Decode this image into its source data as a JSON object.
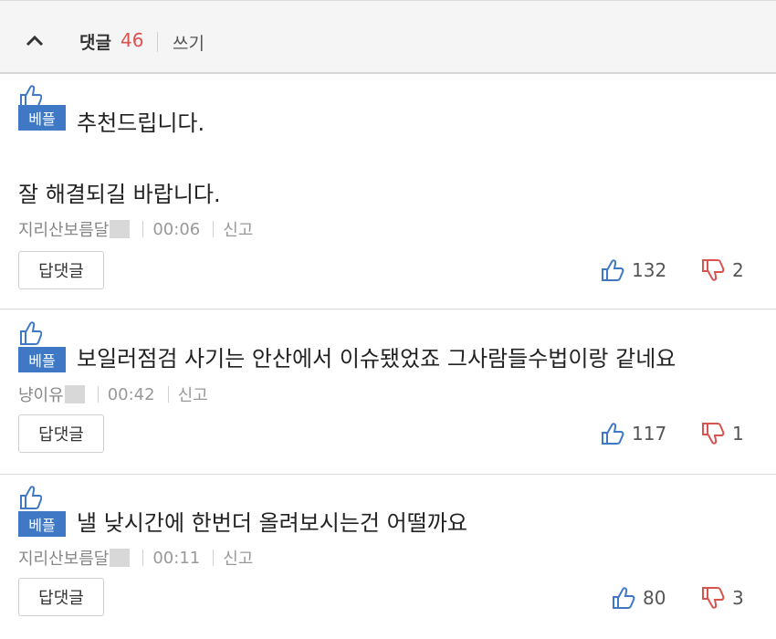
{
  "header": {
    "title": "댓글",
    "count": "46",
    "write_label": "쓰기"
  },
  "comments": [
    {
      "badge": "베플",
      "text_line1": "추천드립니다.",
      "text_line2": "잘 해결되길 바랍니다.",
      "author": "지리산보름달",
      "time": "00:06",
      "report": "신고",
      "reply_label": "답댓글",
      "likes": "132",
      "dislikes": "2"
    },
    {
      "badge": "베플",
      "text_line1": "보일러점검 사기는 안산에서 이슈됐었죠 그사람들수법이랑 같네요",
      "author": "냥이유",
      "time": "00:42",
      "report": "신고",
      "reply_label": "답댓글",
      "likes": "117",
      "dislikes": "1"
    },
    {
      "badge": "베플",
      "text_line1": "낼 낮시간에 한번더 올려보시는건 어떨까요",
      "author": "지리산보름달",
      "time": "00:11",
      "report": "신고",
      "reply_label": "답댓글",
      "likes": "80",
      "dislikes": "3"
    }
  ],
  "colors": {
    "badge": "#3f78c4",
    "like_icon": "#3f78c4",
    "dislike_icon": "#d9534f",
    "count": "#d9534f"
  },
  "icons": {
    "collapse": "chevron-up-icon",
    "badge": "thumbs-up-icon",
    "like": "thumbs-up-icon",
    "dislike": "thumbs-down-icon"
  }
}
